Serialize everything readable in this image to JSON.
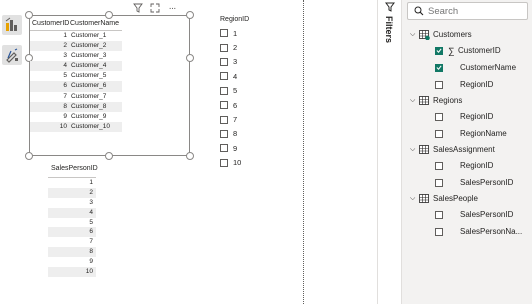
{
  "visual_header": {
    "icons": [
      "filter-icon",
      "focus-mode-icon",
      "more-options-icon"
    ],
    "more_label": "···"
  },
  "customer_table": {
    "columns": [
      "CustomerID",
      "CustomerName"
    ],
    "rows": [
      [
        "1",
        "Customer_1"
      ],
      [
        "2",
        "Customer_2"
      ],
      [
        "3",
        "Customer_3"
      ],
      [
        "4",
        "Customer_4"
      ],
      [
        "5",
        "Customer_5"
      ],
      [
        "6",
        "Customer_6"
      ],
      [
        "7",
        "Customer_7"
      ],
      [
        "8",
        "Customer_8"
      ],
      [
        "9",
        "Customer_9"
      ],
      [
        "10",
        "Customer_10"
      ]
    ]
  },
  "salesperson_table": {
    "column": "SalesPersonID",
    "rows": [
      "1",
      "2",
      "3",
      "4",
      "5",
      "6",
      "7",
      "8",
      "9",
      "10"
    ]
  },
  "region_slicer": {
    "title": "RegionID",
    "items": [
      "1",
      "2",
      "3",
      "4",
      "5",
      "6",
      "7",
      "8",
      "9",
      "10"
    ]
  },
  "filters_pane": {
    "label": "Filters"
  },
  "data_pane": {
    "search_placeholder": "Search",
    "tables": [
      {
        "name": "Customers",
        "fields": [
          {
            "name": "CustomerID",
            "checked": true,
            "sigma": true
          },
          {
            "name": "CustomerName",
            "checked": true,
            "sigma": false
          },
          {
            "name": "RegionID",
            "checked": false,
            "sigma": false
          }
        ]
      },
      {
        "name": "Regions",
        "fields": [
          {
            "name": "RegionID",
            "checked": false,
            "sigma": false
          },
          {
            "name": "RegionName",
            "checked": false,
            "sigma": false
          }
        ]
      },
      {
        "name": "SalesAssignment",
        "fields": [
          {
            "name": "RegionID",
            "checked": false,
            "sigma": false
          },
          {
            "name": "SalesPersonID",
            "checked": false,
            "sigma": false
          }
        ]
      },
      {
        "name": "SalesPeople",
        "fields": [
          {
            "name": "SalesPersonID",
            "checked": false,
            "sigma": false
          },
          {
            "name": "SalesPersonNa...",
            "checked": false,
            "sigma": false
          }
        ]
      }
    ]
  },
  "colors": {
    "accent": "#117865",
    "border": "#8a8886",
    "pane_bg": "#f3f2f1"
  }
}
